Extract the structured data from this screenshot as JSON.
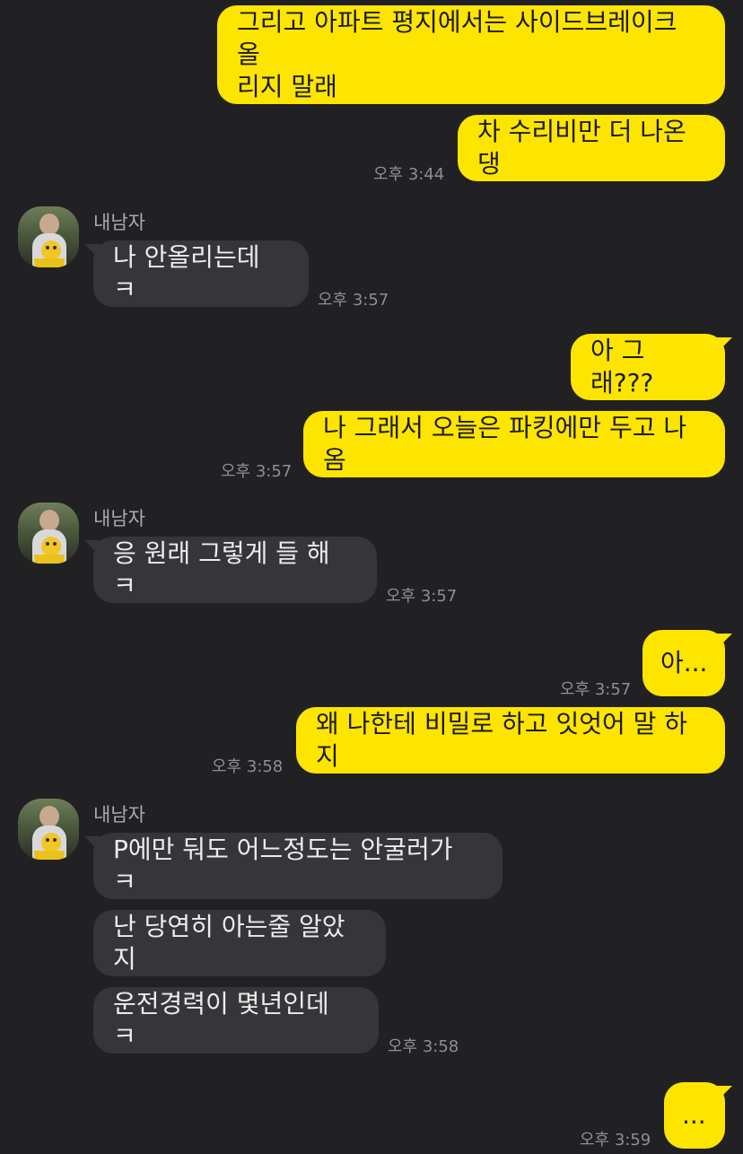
{
  "contact": {
    "name": "내남자"
  },
  "messages": [
    {
      "id": "m1",
      "text": "그리고 아파트 평지에서는 사이드브레이크 올\n리지 말래"
    },
    {
      "id": "m2",
      "text": "차 수리비만 더 나온댕",
      "time": "오후 3:44"
    },
    {
      "id": "m3",
      "text": "나 안올리는데 ㅋ",
      "time": "오후 3:57"
    },
    {
      "id": "m4",
      "text": "아 그래???"
    },
    {
      "id": "m5",
      "text": "나 그래서 오늘은 파킹에만 두고 나옴",
      "time": "오후 3:57"
    },
    {
      "id": "m6",
      "text": "응 원래 그렇게 들 해 ㅋ",
      "time": "오후 3:57"
    },
    {
      "id": "m7",
      "text": "아...",
      "time": "오후 3:57"
    },
    {
      "id": "m8",
      "text": "왜 나한테 비밀로 하고 잇엇어 말 하지",
      "time": "오후 3:58"
    },
    {
      "id": "m9",
      "text": "P에만 둬도 어느정도는 안굴러가 ㅋ"
    },
    {
      "id": "m10",
      "text": "난 당연히 아는줄 알았지"
    },
    {
      "id": "m11",
      "text": "운전경력이 몇년인데 ㅋ",
      "time": "오후 3:58"
    },
    {
      "id": "m12",
      "text": "...",
      "time": "오후 3:59"
    }
  ],
  "colors": {
    "background": "#212124",
    "my_bubble": "#FEE500",
    "their_bubble": "#36363A"
  }
}
